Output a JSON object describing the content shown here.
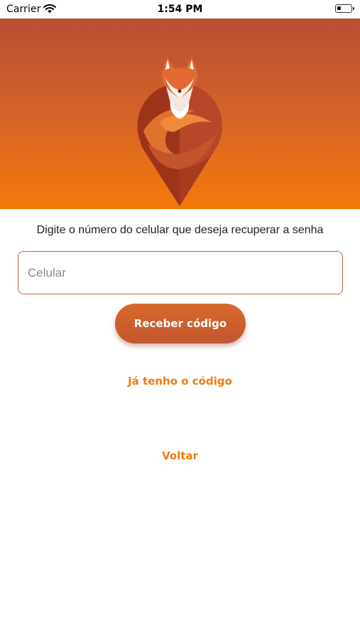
{
  "status_bar": {
    "carrier": "Carrier",
    "time": "1:54 PM",
    "wifi_icon": "wifi-icon",
    "battery_icon": "battery-icon"
  },
  "hero": {
    "logo_icon": "fox-location-pin-logo",
    "gradient_top": "#b84f33",
    "gradient_bottom": "#f47a0b"
  },
  "form": {
    "instruction": "Digite o número do celular que deseja recuperar a senha",
    "phone_placeholder": "Celular",
    "phone_value": "",
    "receive_button": "Receber código"
  },
  "links": {
    "have_code": "Já tenho o código",
    "back": "Voltar"
  },
  "colors": {
    "accent": "#ee7b12",
    "button": "#cd5f2c",
    "input_border": "#c8603e"
  }
}
